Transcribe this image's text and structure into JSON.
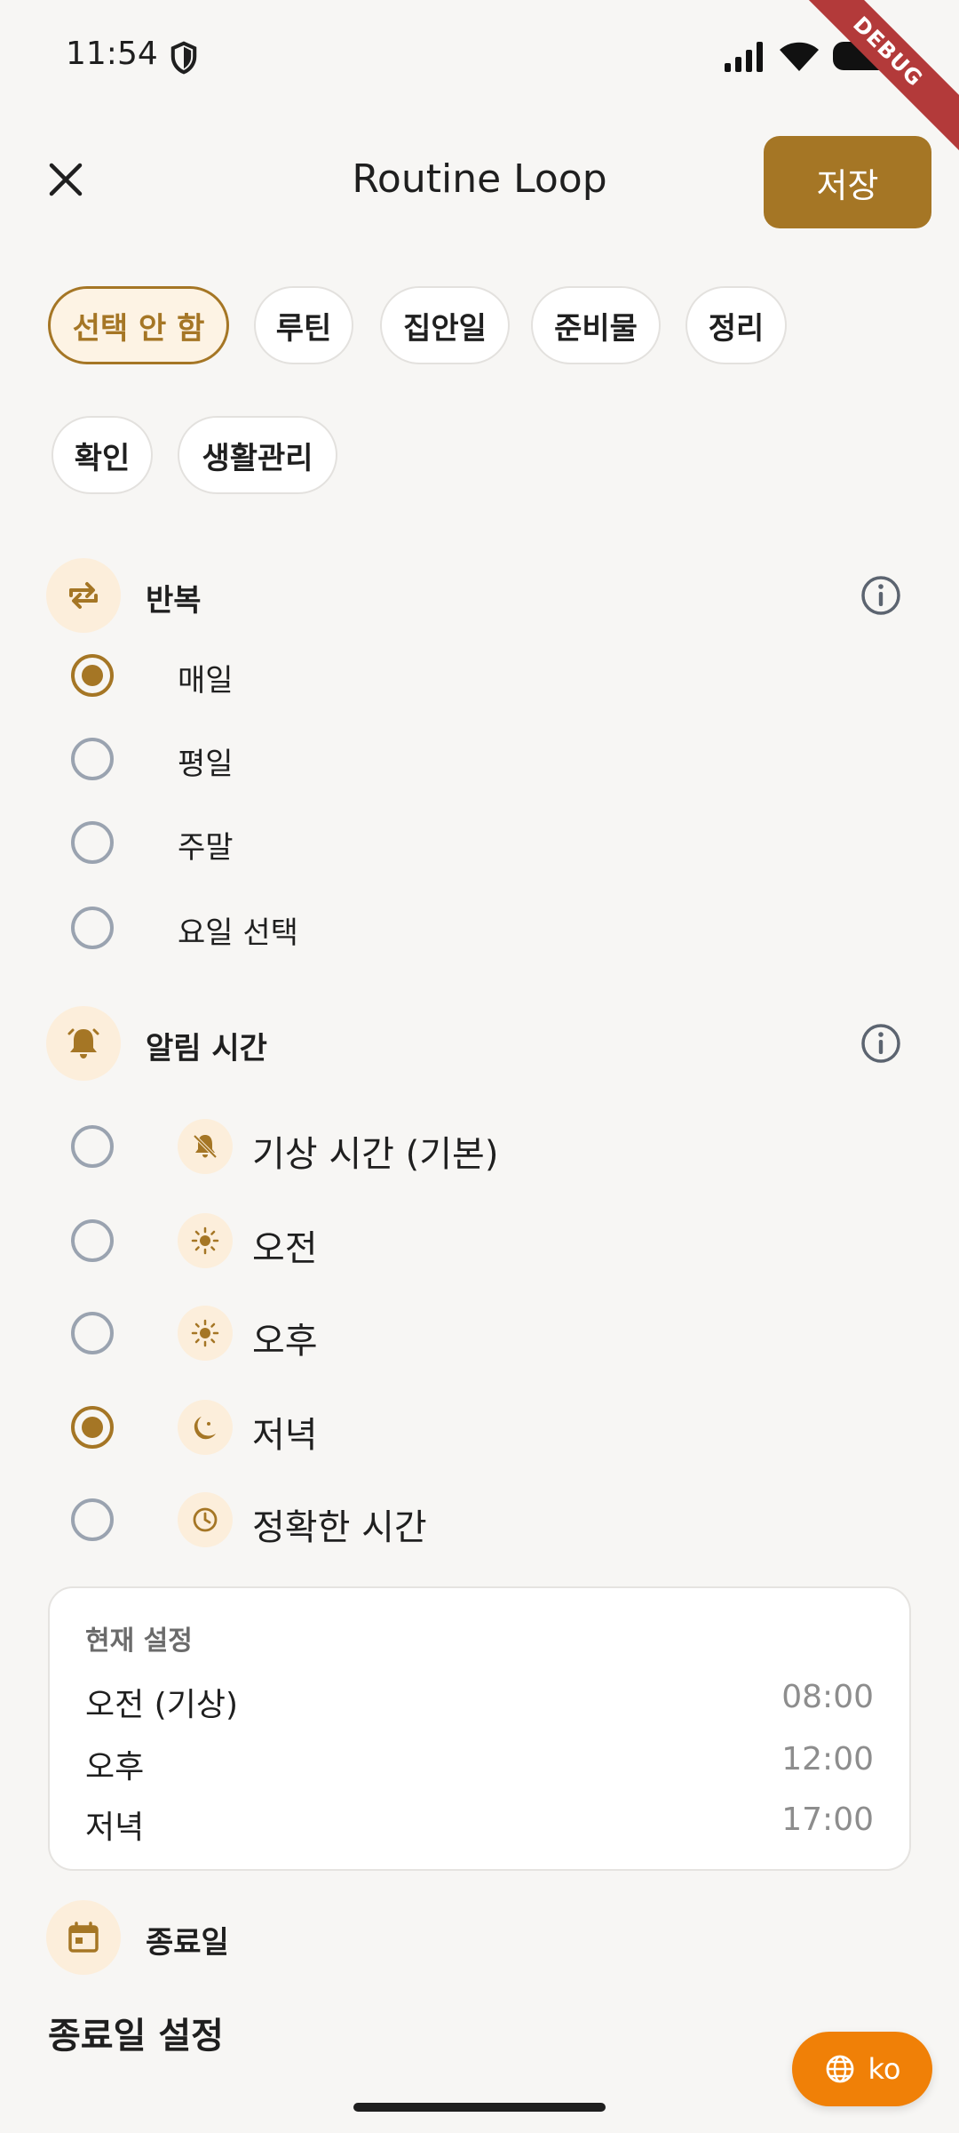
{
  "status_bar": {
    "time": "11:54",
    "debug_label": "DEBUG"
  },
  "app_bar": {
    "title": "Routine Loop",
    "save_label": "저장"
  },
  "chips": {
    "row1": [
      "선택 안 함",
      "루틴",
      "집안일",
      "준비물",
      "정리"
    ],
    "row2": [
      "확인",
      "생활관리"
    ],
    "selected": "선택 안 함"
  },
  "repeat": {
    "title": "반복",
    "options": [
      "매일",
      "평일",
      "주말",
      "요일 선택"
    ],
    "selected": "매일"
  },
  "alarm": {
    "title": "알림 시간",
    "options": [
      {
        "label": "기상 시간 (기본)",
        "icon": "bell-off-icon"
      },
      {
        "label": "오전",
        "icon": "sun-icon"
      },
      {
        "label": "오후",
        "icon": "sun-icon"
      },
      {
        "label": "저녁",
        "icon": "moon-icon"
      },
      {
        "label": "정확한 시간",
        "icon": "clock-icon"
      }
    ],
    "selected": "저녁"
  },
  "current_settings": {
    "title": "현재 설정",
    "rows": [
      {
        "label": "오전 (기상)",
        "time": "08:00"
      },
      {
        "label": "오후",
        "time": "12:00"
      },
      {
        "label": "저녁",
        "time": "17:00"
      }
    ]
  },
  "end_date": {
    "title": "종료일",
    "setting_label": "종료일 설정"
  },
  "language_button": {
    "label": "ko"
  },
  "colors": {
    "accent": "#A57625",
    "accent_bg": "#FCEEDB",
    "lang": "#F08007"
  }
}
